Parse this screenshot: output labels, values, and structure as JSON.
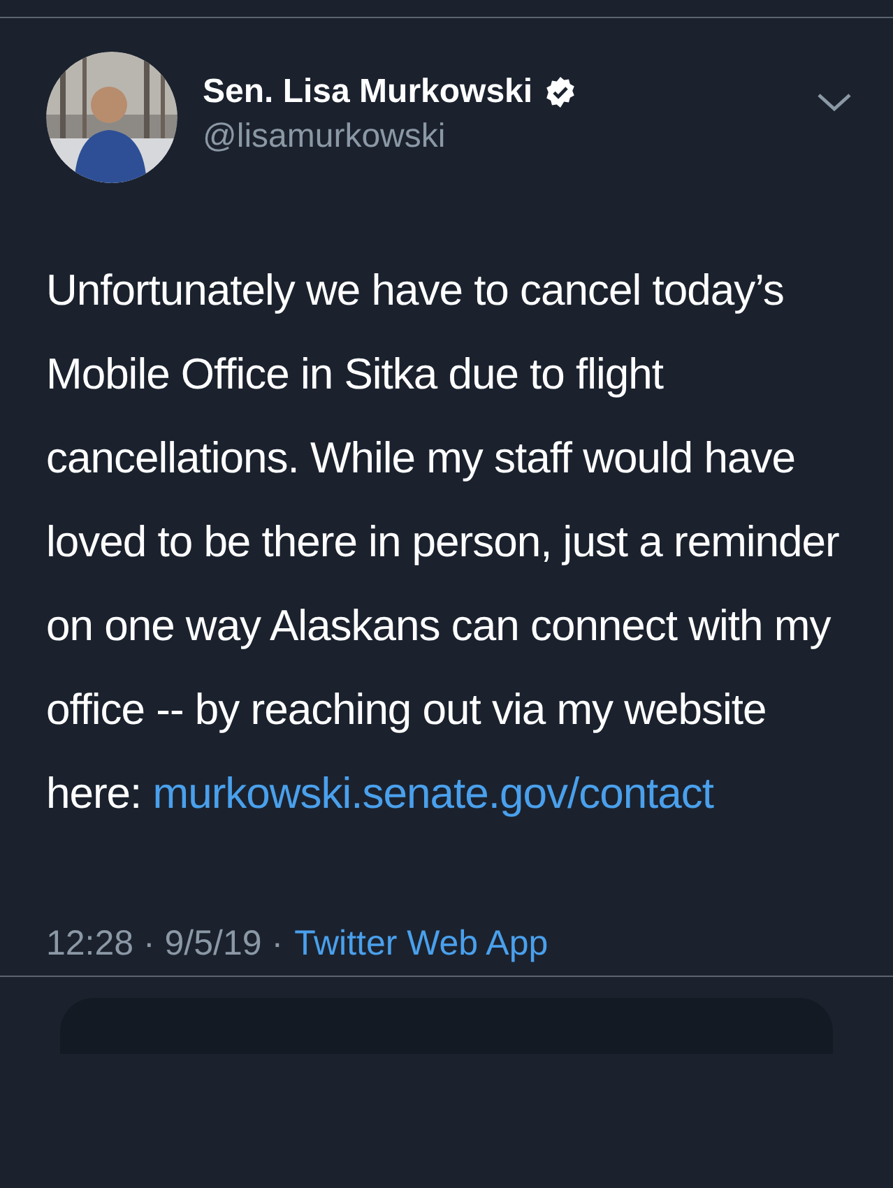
{
  "author": {
    "name": "Sen. Lisa Murkowski",
    "verified": true,
    "handle": "@lisamurkowski"
  },
  "tweet": {
    "text": "Unfortunately we have to cancel today’s Mobile Office in Sitka due to flight cancellations. While my staff would have loved to be there in person, just a reminder on one way Alaskans can connect with my office -- by reaching out via my website here:",
    "link": "murkowski.senate.gov/contact"
  },
  "meta": {
    "timestamp": "12:28 · 9/5/19 ·",
    "source": "Twitter Web App"
  }
}
